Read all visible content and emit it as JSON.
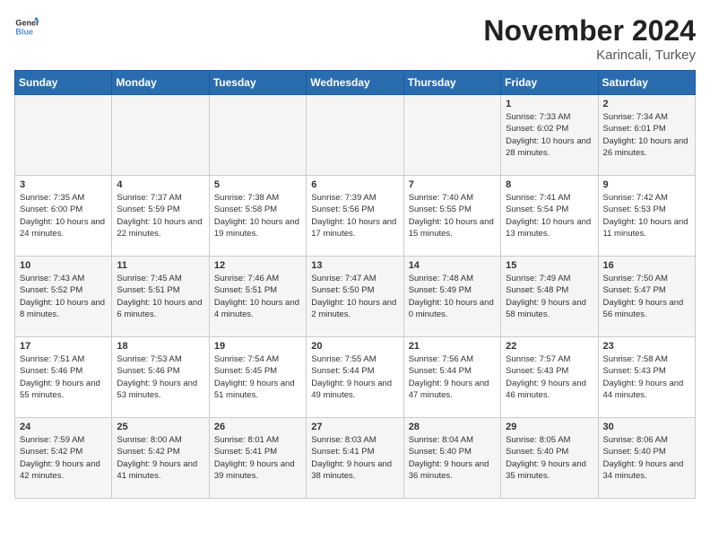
{
  "header": {
    "logo_general": "General",
    "logo_blue": "Blue",
    "month_title": "November 2024",
    "location": "Karincali, Turkey"
  },
  "weekdays": [
    "Sunday",
    "Monday",
    "Tuesday",
    "Wednesday",
    "Thursday",
    "Friday",
    "Saturday"
  ],
  "weeks": [
    [
      {
        "day": "",
        "info": ""
      },
      {
        "day": "",
        "info": ""
      },
      {
        "day": "",
        "info": ""
      },
      {
        "day": "",
        "info": ""
      },
      {
        "day": "",
        "info": ""
      },
      {
        "day": "1",
        "info": "Sunrise: 7:33 AM\nSunset: 6:02 PM\nDaylight: 10 hours and 28 minutes."
      },
      {
        "day": "2",
        "info": "Sunrise: 7:34 AM\nSunset: 6:01 PM\nDaylight: 10 hours and 26 minutes."
      }
    ],
    [
      {
        "day": "3",
        "info": "Sunrise: 7:35 AM\nSunset: 6:00 PM\nDaylight: 10 hours and 24 minutes."
      },
      {
        "day": "4",
        "info": "Sunrise: 7:37 AM\nSunset: 5:59 PM\nDaylight: 10 hours and 22 minutes."
      },
      {
        "day": "5",
        "info": "Sunrise: 7:38 AM\nSunset: 5:58 PM\nDaylight: 10 hours and 19 minutes."
      },
      {
        "day": "6",
        "info": "Sunrise: 7:39 AM\nSunset: 5:56 PM\nDaylight: 10 hours and 17 minutes."
      },
      {
        "day": "7",
        "info": "Sunrise: 7:40 AM\nSunset: 5:55 PM\nDaylight: 10 hours and 15 minutes."
      },
      {
        "day": "8",
        "info": "Sunrise: 7:41 AM\nSunset: 5:54 PM\nDaylight: 10 hours and 13 minutes."
      },
      {
        "day": "9",
        "info": "Sunrise: 7:42 AM\nSunset: 5:53 PM\nDaylight: 10 hours and 11 minutes."
      }
    ],
    [
      {
        "day": "10",
        "info": "Sunrise: 7:43 AM\nSunset: 5:52 PM\nDaylight: 10 hours and 8 minutes."
      },
      {
        "day": "11",
        "info": "Sunrise: 7:45 AM\nSunset: 5:51 PM\nDaylight: 10 hours and 6 minutes."
      },
      {
        "day": "12",
        "info": "Sunrise: 7:46 AM\nSunset: 5:51 PM\nDaylight: 10 hours and 4 minutes."
      },
      {
        "day": "13",
        "info": "Sunrise: 7:47 AM\nSunset: 5:50 PM\nDaylight: 10 hours and 2 minutes."
      },
      {
        "day": "14",
        "info": "Sunrise: 7:48 AM\nSunset: 5:49 PM\nDaylight: 10 hours and 0 minutes."
      },
      {
        "day": "15",
        "info": "Sunrise: 7:49 AM\nSunset: 5:48 PM\nDaylight: 9 hours and 58 minutes."
      },
      {
        "day": "16",
        "info": "Sunrise: 7:50 AM\nSunset: 5:47 PM\nDaylight: 9 hours and 56 minutes."
      }
    ],
    [
      {
        "day": "17",
        "info": "Sunrise: 7:51 AM\nSunset: 5:46 PM\nDaylight: 9 hours and 55 minutes."
      },
      {
        "day": "18",
        "info": "Sunrise: 7:53 AM\nSunset: 5:46 PM\nDaylight: 9 hours and 53 minutes."
      },
      {
        "day": "19",
        "info": "Sunrise: 7:54 AM\nSunset: 5:45 PM\nDaylight: 9 hours and 51 minutes."
      },
      {
        "day": "20",
        "info": "Sunrise: 7:55 AM\nSunset: 5:44 PM\nDaylight: 9 hours and 49 minutes."
      },
      {
        "day": "21",
        "info": "Sunrise: 7:56 AM\nSunset: 5:44 PM\nDaylight: 9 hours and 47 minutes."
      },
      {
        "day": "22",
        "info": "Sunrise: 7:57 AM\nSunset: 5:43 PM\nDaylight: 9 hours and 46 minutes."
      },
      {
        "day": "23",
        "info": "Sunrise: 7:58 AM\nSunset: 5:43 PM\nDaylight: 9 hours and 44 minutes."
      }
    ],
    [
      {
        "day": "24",
        "info": "Sunrise: 7:59 AM\nSunset: 5:42 PM\nDaylight: 9 hours and 42 minutes."
      },
      {
        "day": "25",
        "info": "Sunrise: 8:00 AM\nSunset: 5:42 PM\nDaylight: 9 hours and 41 minutes."
      },
      {
        "day": "26",
        "info": "Sunrise: 8:01 AM\nSunset: 5:41 PM\nDaylight: 9 hours and 39 minutes."
      },
      {
        "day": "27",
        "info": "Sunrise: 8:03 AM\nSunset: 5:41 PM\nDaylight: 9 hours and 38 minutes."
      },
      {
        "day": "28",
        "info": "Sunrise: 8:04 AM\nSunset: 5:40 PM\nDaylight: 9 hours and 36 minutes."
      },
      {
        "day": "29",
        "info": "Sunrise: 8:05 AM\nSunset: 5:40 PM\nDaylight: 9 hours and 35 minutes."
      },
      {
        "day": "30",
        "info": "Sunrise: 8:06 AM\nSunset: 5:40 PM\nDaylight: 9 hours and 34 minutes."
      }
    ]
  ]
}
